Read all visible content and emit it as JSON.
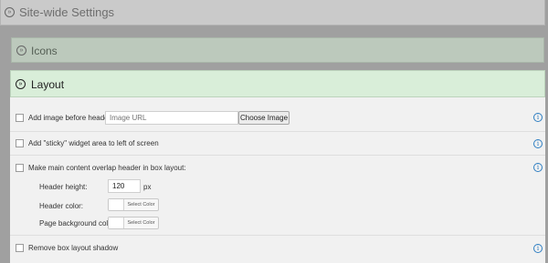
{
  "sections": {
    "site_wide": {
      "title": "Site-wide Settings",
      "icon": "collapse-arrow-icon"
    },
    "icons": {
      "title": "Icons",
      "icon": "collapse-arrow-icon"
    },
    "layout": {
      "title": "Layout",
      "icon": "expand-arrow-icon"
    }
  },
  "rows": {
    "image_before_header": {
      "label": "Add image before header:",
      "url_placeholder": "Image URL",
      "button": "Choose Image"
    },
    "sticky_widget": {
      "label": "Add \"sticky\" widget area to left of screen"
    },
    "overlap_header": {
      "label": "Make main content overlap header in box layout:",
      "header_height": {
        "label": "Header height:",
        "value": "120",
        "unit": "px"
      },
      "header_color": {
        "label": "Header color:",
        "button": "Select Color"
      },
      "page_bg_color": {
        "label": "Page background color:",
        "button": "Select Color"
      }
    },
    "box_shadow": {
      "label": "Remove box layout shadow"
    }
  },
  "colors": {
    "layout_header_bg": "#d9eed9",
    "info_blue": "#2e7ec2"
  }
}
